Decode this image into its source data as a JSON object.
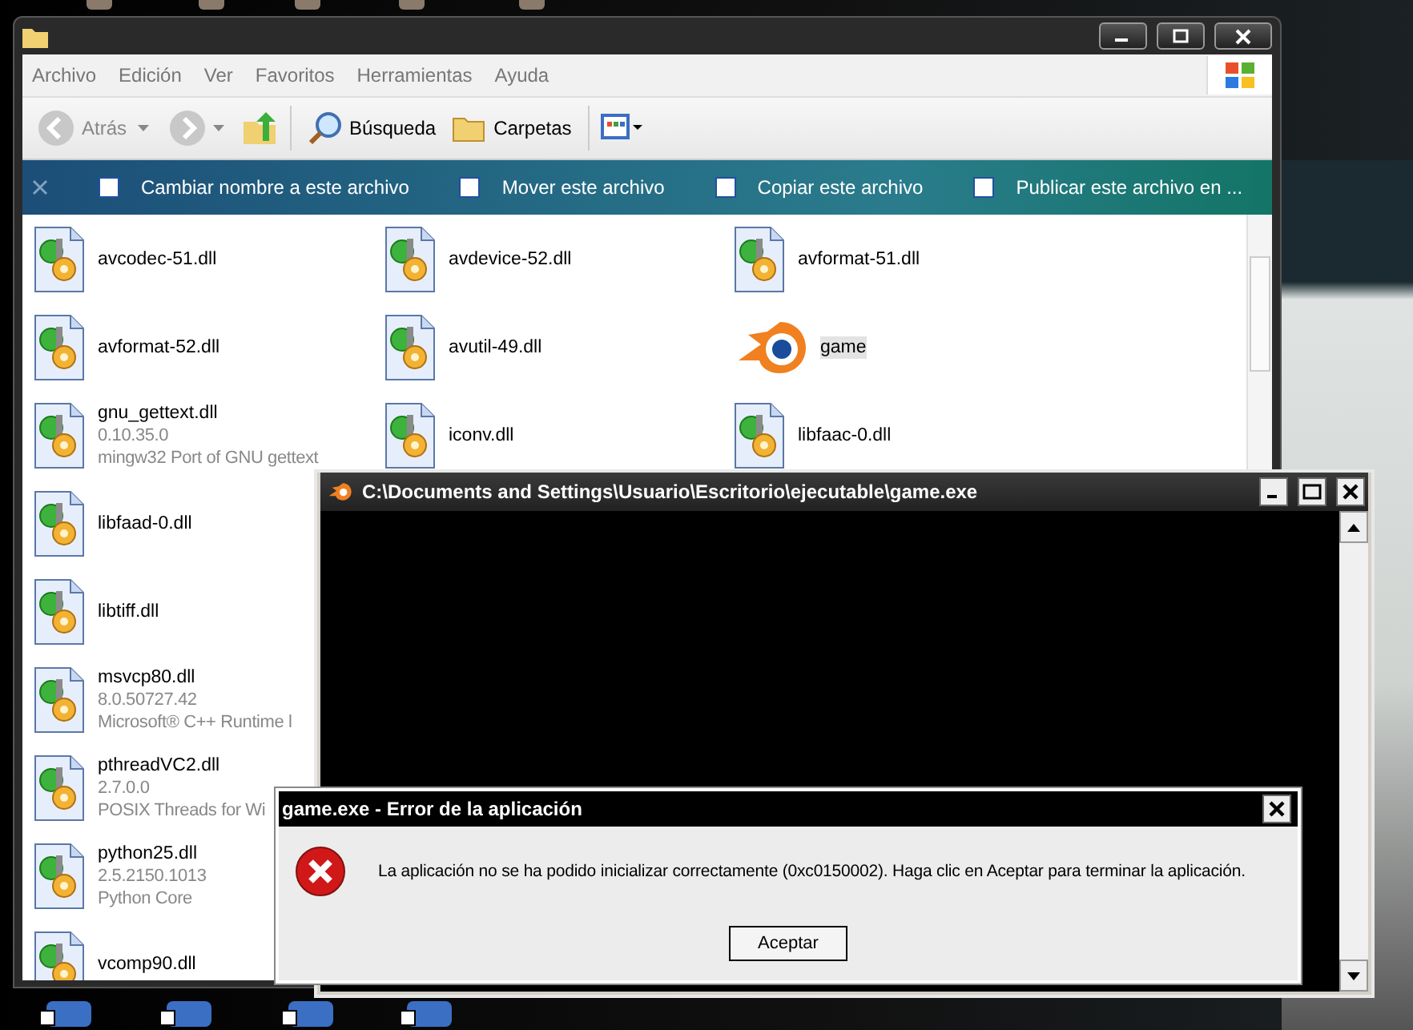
{
  "explorer": {
    "menu": [
      "Archivo",
      "Edición",
      "Ver",
      "Favoritos",
      "Herramientas",
      "Ayuda"
    ],
    "toolbar": {
      "back": {
        "label": "Atrás",
        "disabled": true
      },
      "search": "Búsqueda",
      "folders": "Carpetas"
    },
    "tasks": [
      "Cambiar nombre a este archivo",
      "Mover este archivo",
      "Copiar este archivo",
      "Publicar este archivo en ..."
    ],
    "file_rows": [
      {
        "items": [
          {
            "name": "avcodec-51.dll",
            "kind": "library",
            "selected": false
          },
          {
            "name": "avdevice-52.dll",
            "kind": "library",
            "selected": false
          },
          {
            "name": "avformat-51.dll",
            "kind": "library",
            "selected": false
          }
        ]
      },
      {
        "items": [
          {
            "name": "avformat-52.dll",
            "kind": "library",
            "selected": false
          },
          {
            "name": "avutil-49.dll",
            "kind": "library",
            "selected": false
          },
          {
            "name": "game",
            "kind": "application",
            "selected": true
          }
        ]
      },
      {
        "items": [
          {
            "name": "gnu_gettext.dll",
            "version": "0.10.35.0",
            "description": "mingw32 Port of GNU gettext",
            "kind": "library",
            "selected": false
          },
          {
            "name": "iconv.dll",
            "kind": "library",
            "selected": false
          },
          {
            "name": "libfaac-0.dll",
            "kind": "library",
            "selected": false
          }
        ]
      },
      {
        "items": [
          {
            "name": "libfaad-0.dll",
            "kind": "library",
            "selected": false
          }
        ]
      },
      {
        "items": [
          {
            "name": "libtiff.dll",
            "kind": "library",
            "selected": false
          }
        ]
      },
      {
        "items": [
          {
            "name": "msvcp80.dll",
            "version": "8.0.50727.42",
            "description": "Microsoft® C++ Runtime l",
            "kind": "library",
            "selected": false
          }
        ]
      },
      {
        "items": [
          {
            "name": "pthreadVC2.dll",
            "version": "2.7.0.0",
            "description": "POSIX Threads for Wi",
            "kind": "library",
            "selected": false
          }
        ]
      },
      {
        "items": [
          {
            "name": "python25.dll",
            "version": "2.5.2150.1013",
            "description": "Python Core",
            "kind": "library",
            "selected": false
          }
        ]
      },
      {
        "items": [
          {
            "name": "vcomp90.dll",
            "kind": "library",
            "selected": false
          }
        ]
      }
    ]
  },
  "console": {
    "title": "C:\\Documents and Settings\\Usuario\\Escritorio\\ejecutable\\game.exe"
  },
  "error_dialog": {
    "title": "game.exe - Error de la aplicación",
    "message": "La aplicación no se ha podido inicializar correctamente (0xc0150002). Haga clic en Aceptar para terminar la aplicación.",
    "button": "Aceptar"
  }
}
